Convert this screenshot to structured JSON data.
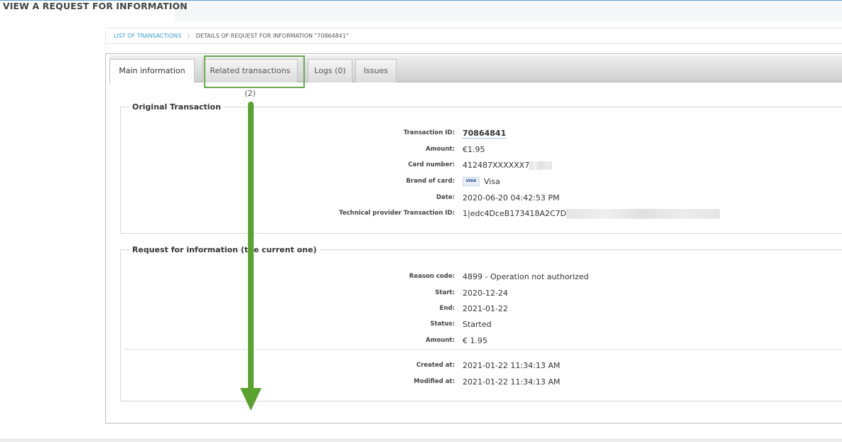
{
  "page": {
    "title": "VIEW A REQUEST FOR INFORMATION"
  },
  "breadcrumb": {
    "link": "LIST OF TRANSACTIONS",
    "separator": "/",
    "current": "DETAILS OF REQUEST FOR INFORMATION \"70864841\""
  },
  "tabs": [
    {
      "label": "Main information",
      "active": true
    },
    {
      "label": "Related transactions (2)",
      "active": false,
      "highlighted": true
    },
    {
      "label": "Logs (0)",
      "active": false
    },
    {
      "label": "Issues",
      "active": false
    }
  ],
  "original_transaction": {
    "legend": "Original Transaction",
    "fields": {
      "transaction_id": {
        "label": "Transaction ID:",
        "value": "70864841"
      },
      "amount": {
        "label": "Amount:",
        "value": "€1.95"
      },
      "card_number": {
        "label": "Card number:",
        "value": "412487XXXXXX7"
      },
      "brand": {
        "label": "Brand of card:",
        "badge": "VISA",
        "value": "Visa"
      },
      "date": {
        "label": "Date:",
        "value": "2020-06-20 04:42:53 PM"
      },
      "tech_provider_id": {
        "label": "Technical provider Transaction ID:",
        "value": "1|edc4DceB173418A2C7D"
      }
    }
  },
  "request_info": {
    "legend": "Request for information (the current one)",
    "fields": {
      "reason_code": {
        "label": "Reason code:",
        "value": "4899 - Operation not authorized"
      },
      "start": {
        "label": "Start:",
        "value": "2020-12-24"
      },
      "end": {
        "label": "End:",
        "value": "2021-01-22"
      },
      "status": {
        "label": "Status:",
        "value": "Started"
      },
      "amount": {
        "label": "Amount:",
        "value": "€ 1.95"
      },
      "created_at": {
        "label": "Created at:",
        "value": "2021-01-22 11:34:13 AM"
      },
      "modified_at": {
        "label": "Modified at:",
        "value": "2021-01-22 11:34:13 AM"
      }
    }
  },
  "annotation": {
    "arrow_color": "#5aa32e",
    "highlight_color": "#6aa84f"
  }
}
